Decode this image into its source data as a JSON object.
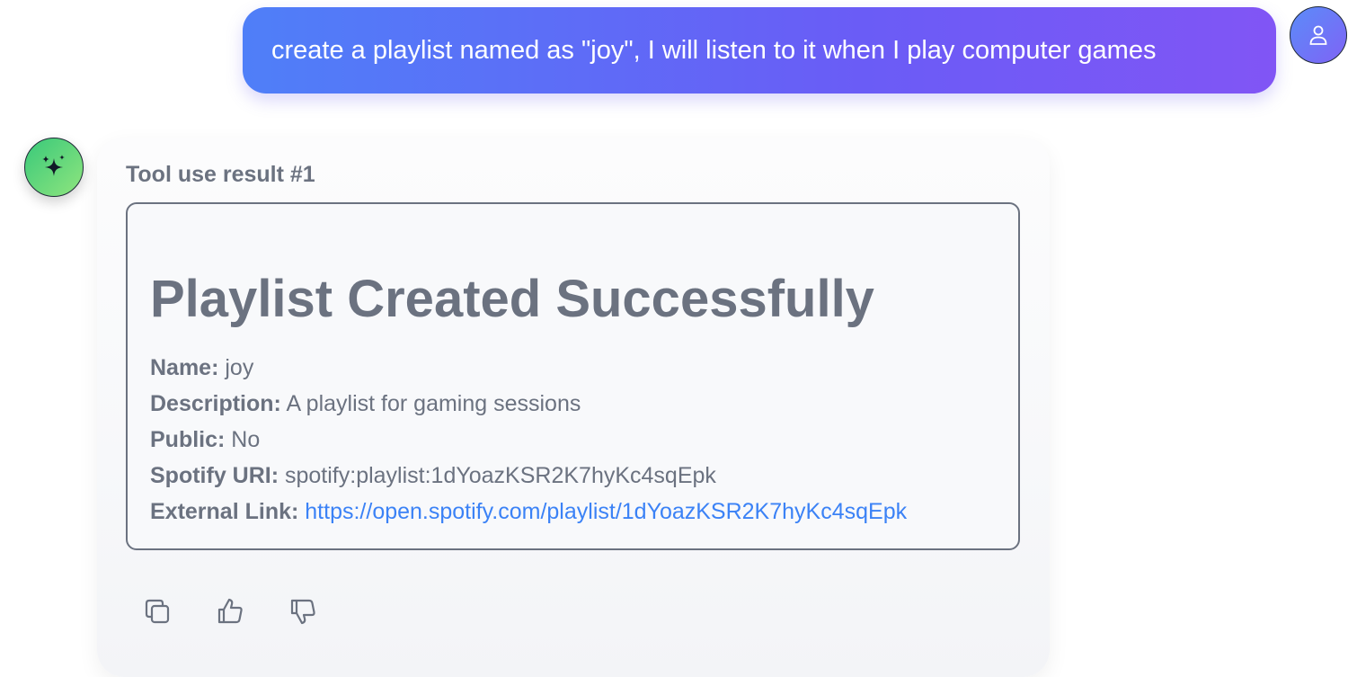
{
  "user_message": {
    "text": "create a playlist named as \"joy\", I will listen to it when I play computer games",
    "avatar_icon": "user-icon"
  },
  "assistant": {
    "avatar_icon": "sparkle-icon",
    "tool_label": "Tool use result #1",
    "result": {
      "title": "Playlist Created Successfully",
      "fields": [
        {
          "label": "Name:",
          "value": "joy"
        },
        {
          "label": "Description:",
          "value": "A playlist for gaming sessions"
        },
        {
          "label": "Public:",
          "value": "No"
        },
        {
          "label": "Spotify URI:",
          "value": "spotify:playlist:1dYoazKSR2K7hyKc4sqEpk"
        },
        {
          "label": "External Link:",
          "value": "https://open.spotify.com/playlist/1dYoazKSR2K7hyKc4sqEpk"
        }
      ]
    },
    "actions": [
      {
        "name": "copy",
        "icon": "copy-icon"
      },
      {
        "name": "like",
        "icon": "thumbs-up-icon"
      },
      {
        "name": "dislike",
        "icon": "thumbs-down-icon"
      }
    ]
  },
  "colors": {
    "user_gradient_start": "#4f7ff8",
    "user_gradient_end": "#8155f5",
    "bot_avatar_start": "#39c97a",
    "bot_avatar_end": "#8fe57e",
    "muted_text": "#6b7280",
    "link": "#3b82f6"
  }
}
